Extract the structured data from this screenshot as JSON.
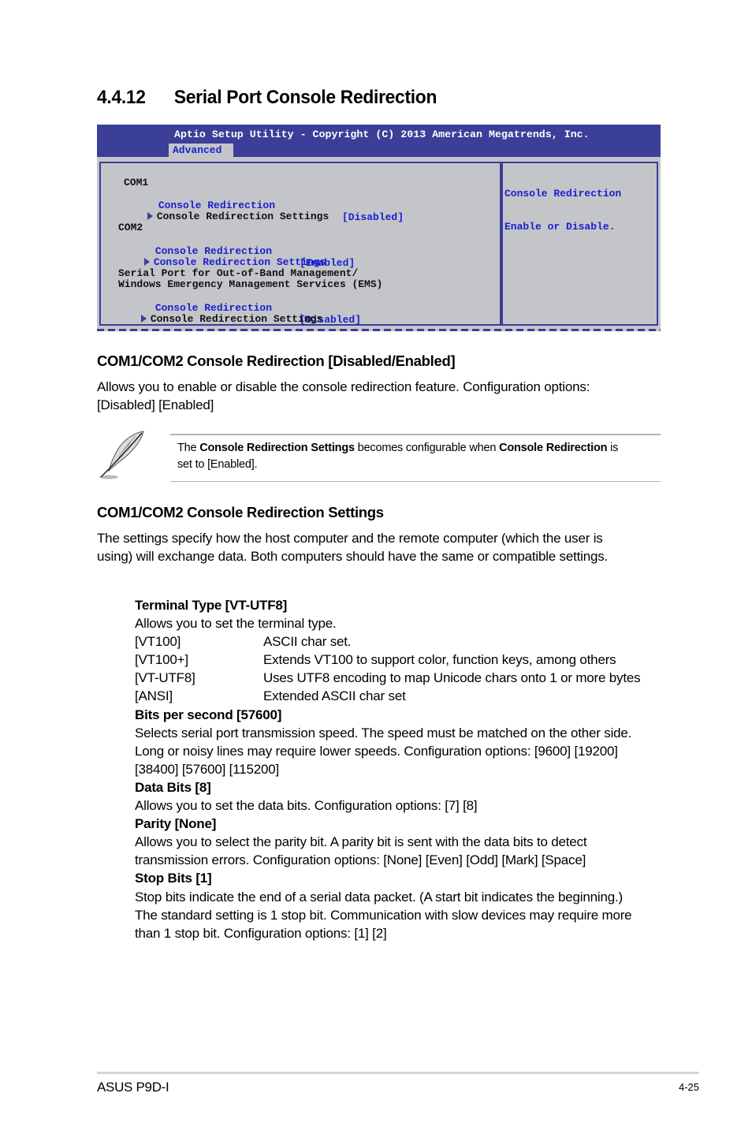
{
  "section": {
    "number": "4.4.12",
    "title": "Serial Port Console Redirection"
  },
  "bios": {
    "copyright": "Aptio Setup Utility - Copyright (C) 2013 American Megatrends, Inc.",
    "active_tab": "Advanced",
    "com1": {
      "label": "COM1",
      "redirection_label": "Console Redirection",
      "redirection_value": "[Disabled]",
      "settings_label": "Console Redirection Settings"
    },
    "com2": {
      "label": "COM2",
      "redirection_label": "Console Redirection",
      "redirection_value": "[Enabled]",
      "settings_label": "Console Redirection Settings"
    },
    "ems": {
      "label_line1": "Serial Port for Out-of-Band Management/",
      "label_line2": "Windows Emergency Management Services (EMS)",
      "redirection_label": "Console Redirection",
      "redirection_value": "[Disabled]",
      "settings_label": "Console Redirection Settings"
    },
    "help": {
      "line1": "Console Redirection",
      "line2": "Enable or Disable."
    }
  },
  "redirection_section": {
    "heading": "COM1/COM2 Console Redirection [Disabled/Enabled]",
    "line1": "Allows you to enable or disable the console redirection feature. Configuration options:",
    "line2": "[Disabled] [Enabled]"
  },
  "note": {
    "icon": "feather-pen-icon",
    "prefix": "The ",
    "bold1": "Console Redirection Settings",
    "middle": " becomes configurable when ",
    "bold2": "Console Redirection",
    "suffix": " is",
    "line2": "set to [Enabled]."
  },
  "settings_section": {
    "heading": "COM1/COM2 Console Redirection Settings",
    "line1": "The settings specify how the host computer and the remote computer (which the user is",
    "line2": "using) will exchange data. Both computers should have the same or compatible settings."
  },
  "items": {
    "terminal": {
      "title": "Terminal Type [VT-UTF8]",
      "desc": "Allows you to set the terminal type.",
      "options": [
        {
          "key": "[VT100]",
          "desc": "ASCII char set."
        },
        {
          "key": "[VT100+]",
          "desc": "Extends VT100 to support color, function keys, among others"
        },
        {
          "key": "[VT-UTF8]",
          "desc": "Uses UTF8 encoding to map Unicode chars onto 1 or more bytes"
        },
        {
          "key": "[ANSI]",
          "desc": "Extended ASCII char set"
        }
      ]
    },
    "bps": {
      "title": "Bits per second [57600]",
      "lines": [
        "Selects serial port transmission speed. The speed must be matched on the other side.",
        "Long or noisy lines may require lower speeds. Configuration options: [9600] [19200]",
        "[38400] [57600] [115200]"
      ]
    },
    "databits": {
      "title": "Data Bits [8]",
      "lines": [
        "Allows you to set the data bits. Configuration options: [7] [8]"
      ]
    },
    "parity": {
      "title": "Parity [None]",
      "lines": [
        "Allows you to select the parity bit. A parity bit is sent with the data bits to detect",
        "transmission errors. Configuration options: [None] [Even] [Odd] [Mark] [Space]"
      ]
    },
    "stopbits": {
      "title": "Stop Bits [1]",
      "lines": [
        "Stop bits indicate the end of a serial data packet. (A start bit indicates the beginning.)",
        "The standard setting is 1 stop bit. Communication with slow devices may require more",
        "than 1 stop bit. Configuration options: [1] [2]"
      ]
    }
  },
  "footer": {
    "left": "ASUS P9D-I",
    "right": "4-25"
  },
  "colors": {
    "bios_header": "#3b3f97",
    "bios_bg": "#c3c5c9",
    "bios_highlight": "#1a1fd0"
  }
}
